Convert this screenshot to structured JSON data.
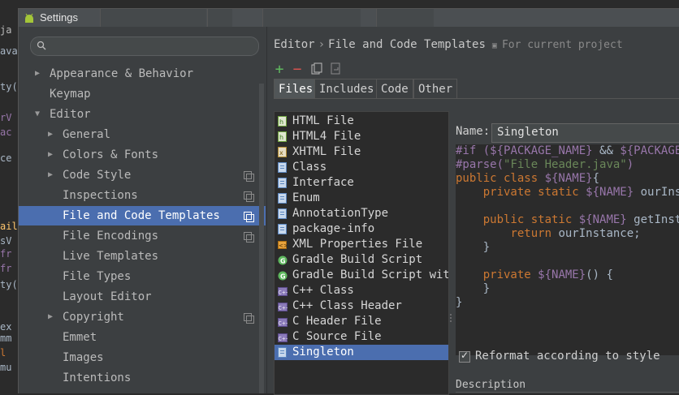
{
  "window": {
    "title": "Settings"
  },
  "background_editor": {
    "fragments": [
      "ja",
      "ava",
      "ty(",
      "rV",
      "ac",
      "ce",
      "ail",
      "sV",
      "fr",
      "fr",
      "ty(",
      "ex",
      "mm",
      "l",
      "mu"
    ]
  },
  "search": {
    "placeholder": ""
  },
  "tree": [
    {
      "label": "Appearance & Behavior",
      "level": 0,
      "arrow": "collapsed",
      "copy": false
    },
    {
      "label": "Keymap",
      "level": 0,
      "arrow": "none",
      "copy": false
    },
    {
      "label": "Editor",
      "level": 0,
      "arrow": "expanded",
      "copy": false
    },
    {
      "label": "General",
      "level": 1,
      "arrow": "collapsed",
      "copy": false
    },
    {
      "label": "Colors & Fonts",
      "level": 1,
      "arrow": "collapsed",
      "copy": false
    },
    {
      "label": "Code Style",
      "level": 1,
      "arrow": "collapsed",
      "copy": true
    },
    {
      "label": "Inspections",
      "level": 1,
      "arrow": "none",
      "copy": true
    },
    {
      "label": "File and Code Templates",
      "level": 1,
      "arrow": "none",
      "copy": true,
      "selected": true
    },
    {
      "label": "File Encodings",
      "level": 1,
      "arrow": "none",
      "copy": true
    },
    {
      "label": "Live Templates",
      "level": 1,
      "arrow": "none",
      "copy": false
    },
    {
      "label": "File Types",
      "level": 1,
      "arrow": "none",
      "copy": false
    },
    {
      "label": "Layout Editor",
      "level": 1,
      "arrow": "none",
      "copy": false
    },
    {
      "label": "Copyright",
      "level": 1,
      "arrow": "collapsed",
      "copy": true
    },
    {
      "label": "Emmet",
      "level": 1,
      "arrow": "none",
      "copy": false
    },
    {
      "label": "Images",
      "level": 1,
      "arrow": "none",
      "copy": false
    },
    {
      "label": "Intentions",
      "level": 1,
      "arrow": "none",
      "copy": false
    }
  ],
  "breadcrumb": {
    "part1": "Editor",
    "separator": "›",
    "part2": "File and Code Templates",
    "scope": "For current project"
  },
  "toolbar": {
    "add": "+",
    "remove": "−"
  },
  "tabs": [
    "Files",
    "Includes",
    "Code",
    "Other"
  ],
  "active_tab": "Files",
  "files": [
    {
      "label": "HTML File",
      "icon": "html-file-icon"
    },
    {
      "label": "HTML4 File",
      "icon": "html-file-icon"
    },
    {
      "label": "XHTML File",
      "icon": "xhtml-file-icon"
    },
    {
      "label": "Class",
      "icon": "java-file-icon"
    },
    {
      "label": "Interface",
      "icon": "java-file-icon"
    },
    {
      "label": "Enum",
      "icon": "java-file-icon"
    },
    {
      "label": "AnnotationType",
      "icon": "java-file-icon"
    },
    {
      "label": "package-info",
      "icon": "java-file-icon"
    },
    {
      "label": "XML Properties File",
      "icon": "xml-file-icon"
    },
    {
      "label": "Gradle Build Script",
      "icon": "gradle-icon"
    },
    {
      "label": "Gradle Build Script with",
      "icon": "gradle-icon"
    },
    {
      "label": "C++ Class",
      "icon": "cpp-icon"
    },
    {
      "label": "C++ Class Header",
      "icon": "cpp-icon"
    },
    {
      "label": "C Header File",
      "icon": "cpp-icon"
    },
    {
      "label": "C Source File",
      "icon": "cpp-icon"
    },
    {
      "label": "Singleton",
      "icon": "java-file-icon",
      "selected": true
    }
  ],
  "name_field": {
    "label": "Name:",
    "value": "Singleton"
  },
  "code_lines": [
    [
      [
        "dir",
        "#if ("
      ],
      [
        "vm",
        "${PACKAGE_NAME}"
      ],
      [
        "txt",
        " && "
      ],
      [
        "vm",
        "${PACKAGE_NAME}"
      ]
    ],
    [
      [
        "dir",
        "#parse("
      ],
      [
        "str",
        "\"File Header.java\""
      ],
      [
        "dir",
        ")"
      ]
    ],
    [
      [
        "kw",
        "public class "
      ],
      [
        "vm",
        "${NAME}"
      ],
      [
        "txt",
        "{"
      ]
    ],
    [
      [
        "txt",
        "    "
      ],
      [
        "kw",
        "private static "
      ],
      [
        "vm",
        "${NAME}"
      ],
      [
        "txt",
        " ourInstance"
      ]
    ],
    [
      [
        "txt",
        ""
      ]
    ],
    [
      [
        "txt",
        "    "
      ],
      [
        "kw",
        "public static "
      ],
      [
        "vm",
        "${NAME}"
      ],
      [
        "txt",
        " getInstance"
      ]
    ],
    [
      [
        "txt",
        "        "
      ],
      [
        "kw",
        "return "
      ],
      [
        "txt",
        "ourInstance;"
      ]
    ],
    [
      [
        "txt",
        "    }"
      ]
    ],
    [
      [
        "txt",
        ""
      ]
    ],
    [
      [
        "txt",
        "    "
      ],
      [
        "kw",
        "private "
      ],
      [
        "vm",
        "${NAME}"
      ],
      [
        "txt",
        "() {"
      ]
    ],
    [
      [
        "txt",
        "    }"
      ]
    ],
    [
      [
        "txt",
        "}"
      ]
    ]
  ],
  "reformat": {
    "label": "Reformat according to style",
    "checked": true
  },
  "description": {
    "label": "Description"
  },
  "colors": {
    "selection": "#4b6eaf",
    "keyword": "#cc7832",
    "variable": "#9876aa",
    "string": "#6a8759"
  }
}
